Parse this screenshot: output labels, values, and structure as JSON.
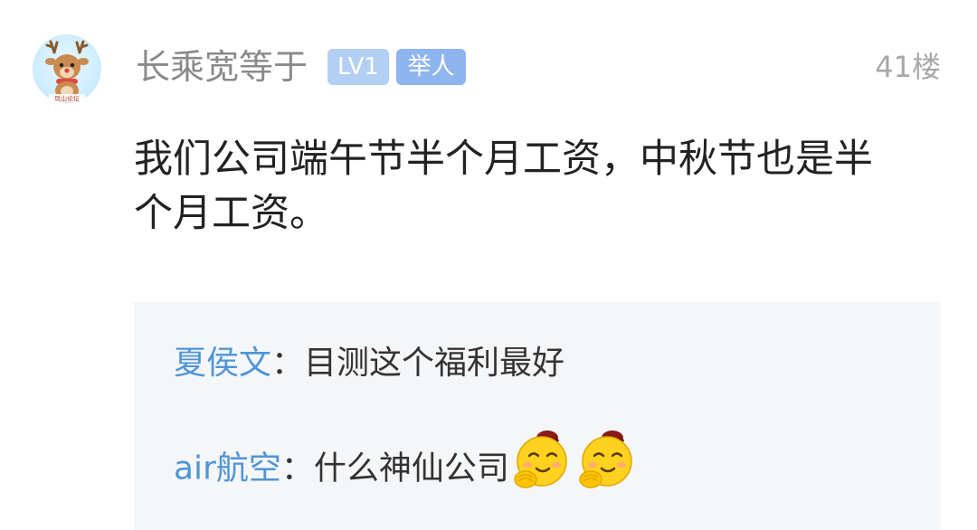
{
  "post": {
    "username": "长乘宽等于",
    "level_badge": "LV1",
    "role_badge": "举人",
    "floor": "41楼",
    "content": "我们公司端午节半个月工资，中秋节也是半个月工资。",
    "avatar_caption": "凤山论坛"
  },
  "replies": [
    {
      "author": "夏侯文",
      "separator": "：",
      "text": "目测这个福利最好",
      "emojis": []
    },
    {
      "author": "air航空",
      "separator": "：",
      "text": "什么神仙公司",
      "emojis": [
        "bowing-smiley-icon",
        "bowing-smiley-icon"
      ]
    }
  ],
  "colors": {
    "username": "#8a8a8a",
    "level_badge": "#b3cff3",
    "role_badge": "#8fb5ef",
    "reply_author": "#4f95d6",
    "reply_background": "#f5f6f8"
  }
}
